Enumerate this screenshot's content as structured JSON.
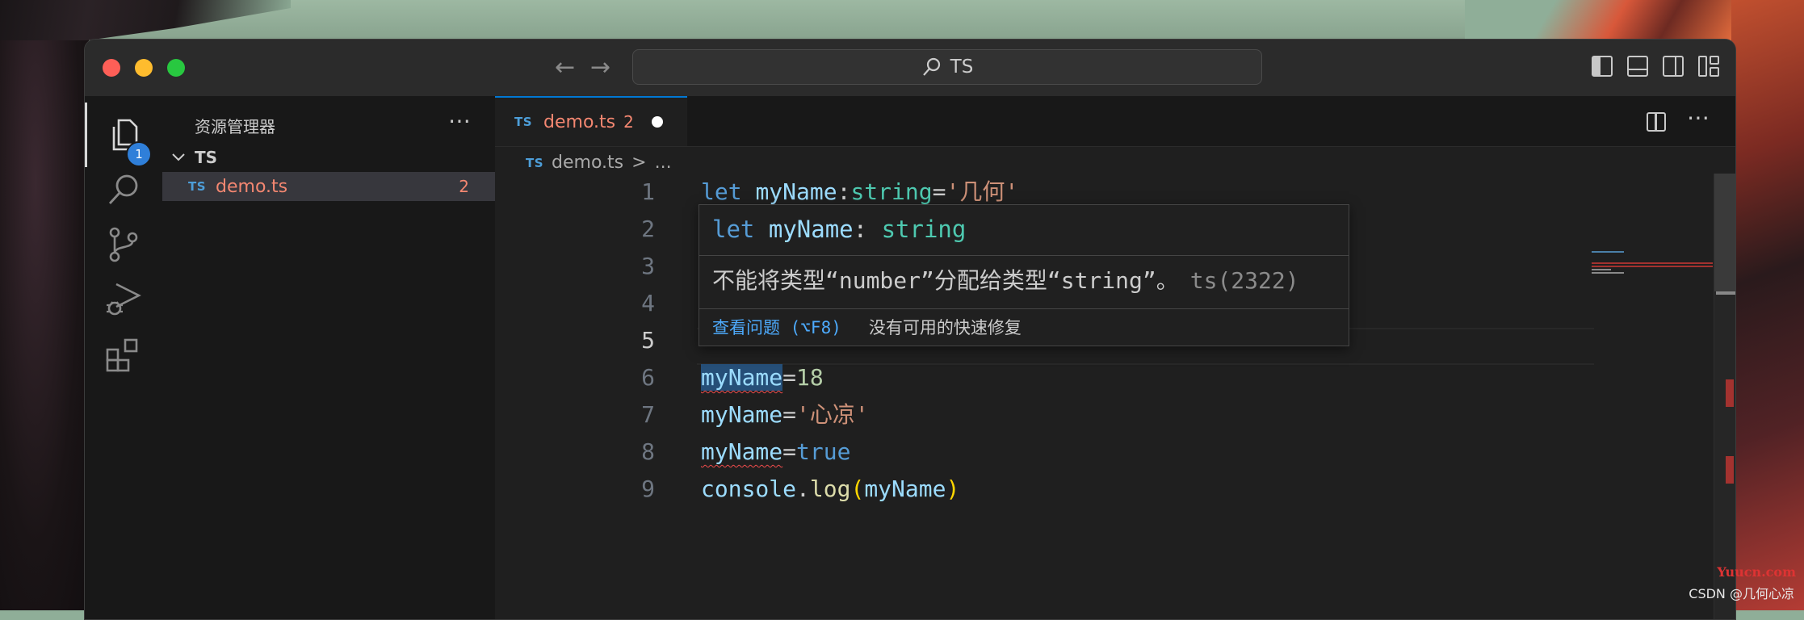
{
  "window": {
    "search_text": "TS"
  },
  "sidebar": {
    "title": "资源管理器",
    "more_glyph": "⋯",
    "folder": "TS",
    "files": [
      {
        "type_tag": "TS",
        "name": "demo.ts",
        "problems": "2"
      }
    ]
  },
  "activity": {
    "explorer_badge": "1"
  },
  "editor": {
    "tab": {
      "type_tag": "TS",
      "name": "demo.ts",
      "problems": "2"
    },
    "breadcrumb": {
      "type_tag": "TS",
      "file": "demo.ts",
      "sep": ">",
      "rest": "..."
    },
    "line_numbers": [
      "1",
      "2",
      "3",
      "4",
      "5",
      "6",
      "7",
      "8",
      "9"
    ],
    "current_line": "5",
    "code": {
      "l1": {
        "kw": "let",
        "var": "myName",
        "colon": ":",
        "type": "string",
        "eq": "=",
        "str": "'几何'"
      },
      "l6": {
        "var": "myName",
        "eq": "=",
        "num": "18"
      },
      "l7": {
        "var": "myName",
        "eq": "=",
        "str": "'心凉'"
      },
      "l8": {
        "var": "myName",
        "eq": "=",
        "val": "true"
      },
      "l9": {
        "obj": "console",
        "dot": ".",
        "fn": "log",
        "open": "(",
        "arg": "myName",
        "close": ")"
      }
    }
  },
  "hover": {
    "sig_kw": "let",
    "sig_var": "myName",
    "sig_colon": ":",
    "sig_type": "string",
    "message": "不能将类型“number”分配给类型“string”。",
    "code": "ts(2322)",
    "view_problem": "查看问题 (⌥F8)",
    "no_fix": "没有可用的快速修复"
  },
  "watermark": {
    "site": "Yuucn.com",
    "credit": "CSDN @几何心凉"
  },
  "colors": {
    "accent": "#0078d4",
    "error": "#f48771",
    "badge": "#2f7fd9"
  },
  "icons": [
    "explorer-icon",
    "search-icon",
    "source-control-icon",
    "run-debug-icon",
    "extensions-icon",
    "split-editor-icon",
    "layout-icon"
  ]
}
